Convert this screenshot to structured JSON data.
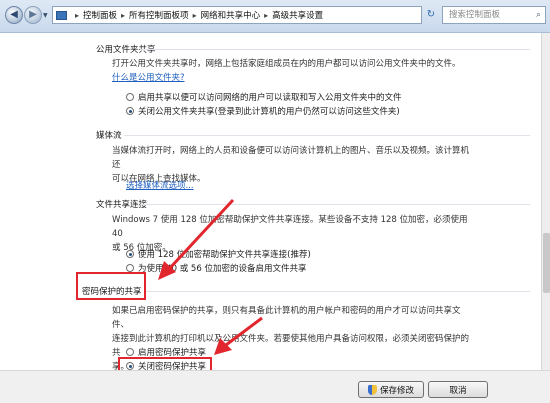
{
  "address_bar": {
    "breadcrumbs": [
      "控制面板",
      "所有控制面板项",
      "网络和共享中心",
      "高级共享设置"
    ],
    "search_placeholder": "搜索控制面板"
  },
  "sections": {
    "public_folder": {
      "title": "公用文件夹共享",
      "description": "打开公用文件夹共享时，网络上包括家庭组成员在内的用户都可以访问公用文件夹中的文件。",
      "link": "什么是公用文件夹?",
      "options": [
        {
          "label": "启用共享以便可以访问网络的用户可以读取和写入公用文件夹中的文件",
          "selected": false
        },
        {
          "label": "关闭公用文件夹共享(登录到此计算机的用户仍然可以访问这些文件夹)",
          "selected": true
        }
      ]
    },
    "media": {
      "title": "媒体流",
      "description_1": "当媒体流打开时，网络上的人员和设备便可以访问该计算机上的图片、音乐以及视频。该计算机还",
      "description_2": "可以在网络上查找媒体。",
      "link": "选择媒体流选项..."
    },
    "file_sharing": {
      "title": "文件共享连接",
      "description_1": "Windows 7 使用 128 位加密帮助保护文件共享连接。某些设备不支持 128 位加密，必须使用 40",
      "description_2": "或 56 位加密。",
      "options": [
        {
          "label": "使用 128 位加密帮助保护文件共享连接(推荐)",
          "selected": true
        },
        {
          "label": "为使用 40 或 56 位加密的设备启用文件共享",
          "selected": false
        }
      ]
    },
    "password": {
      "title": "密码保护的共享",
      "description_1": "如果已启用密码保护的共享，则只有具备此计算机的用户帐户和密码的用户才可以访问共享文件、",
      "description_2": "连接到此计算机的打印机以及公用文件夹。若要使其他用户具备访问权限，必须关闭密码保护的共",
      "description_3": "享。",
      "options": [
        {
          "label": "启用密码保护共享",
          "selected": false
        },
        {
          "label": "关闭密码保护共享",
          "selected": true
        }
      ]
    }
  },
  "footer": {
    "save_label": "保存修改",
    "cancel_label": "取消"
  },
  "colors": {
    "highlight": "#e2262d",
    "link": "#1e5fbf"
  }
}
